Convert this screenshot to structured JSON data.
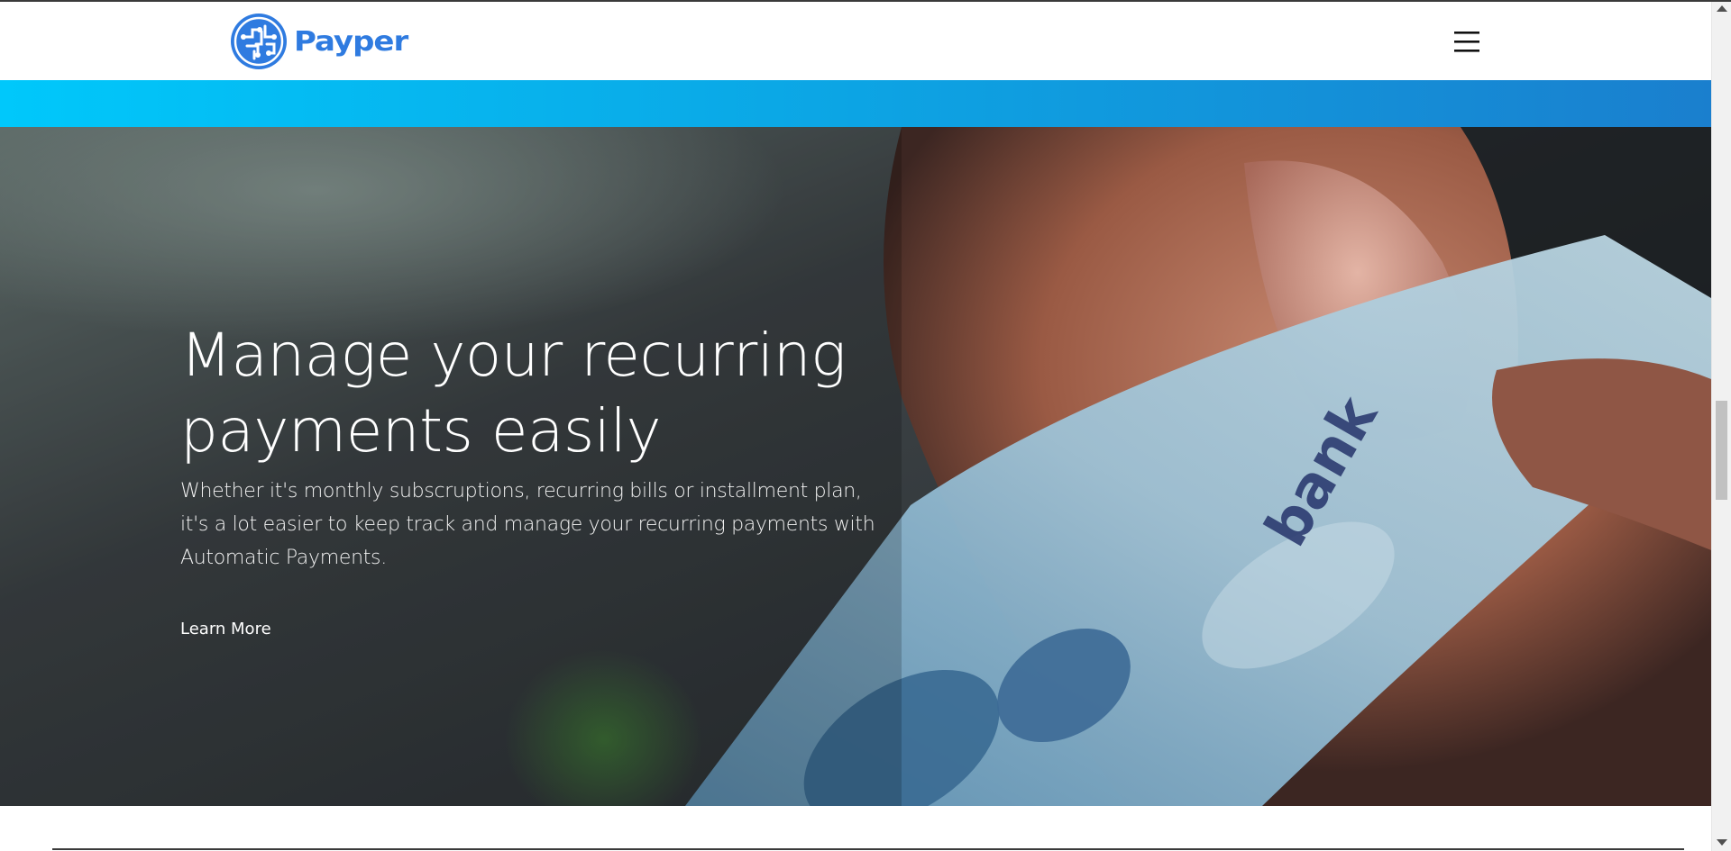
{
  "header": {
    "brand_name": "Payper",
    "brand_color": "#2f7be0",
    "logo_icon": "circuit-globe-logo-icon",
    "menu_icon": "hamburger-menu-icon"
  },
  "accent_band": {
    "gradient_start": "#00c8fb",
    "gradient_end": "#1a7fce"
  },
  "hero": {
    "title_line1": "Manage your recurring",
    "title_line2": "payments easily",
    "description": "Whether it's monthly subscruptions, recurring bills or installment plan, it's a lot easier to keep track and manage your recurring payments with Automatic Payments.",
    "cta_label": "Learn More",
    "background_image": "hand holding bank credit card photo",
    "card_text": "bank"
  }
}
